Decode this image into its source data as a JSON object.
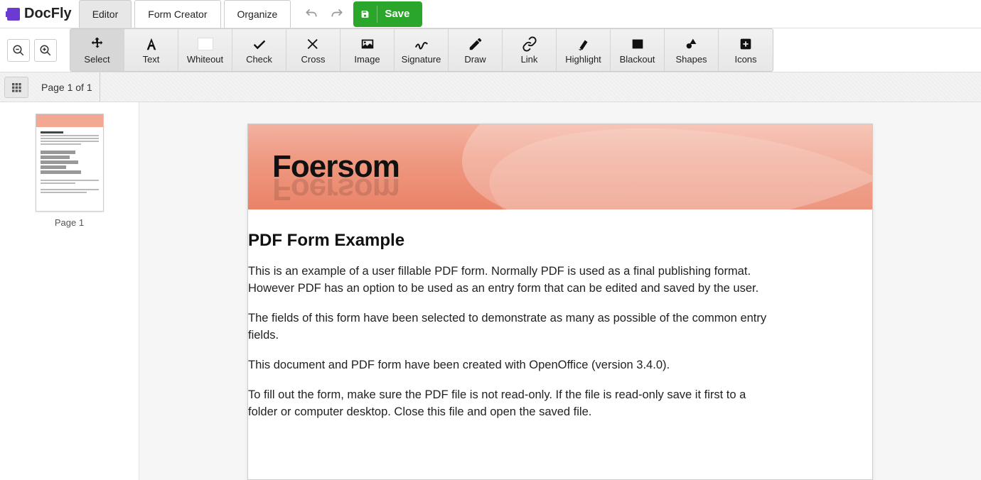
{
  "app": {
    "name": "DocFly"
  },
  "tabs": {
    "editor": "Editor",
    "form_creator": "Form Creator",
    "organize": "Organize"
  },
  "header": {
    "save": "Save"
  },
  "tools": {
    "select": "Select",
    "text": "Text",
    "whiteout": "Whiteout",
    "check": "Check",
    "cross": "Cross",
    "image": "Image",
    "signature": "Signature",
    "draw": "Draw",
    "link": "Link",
    "highlight": "Highlight",
    "blackout": "Blackout",
    "shapes": "Shapes",
    "icons": "Icons"
  },
  "pagebar": {
    "indicator": "Page 1 of 1"
  },
  "sidebar": {
    "thumb_label": "Page 1"
  },
  "document": {
    "banner_title": "Foersom",
    "heading": "PDF Form Example",
    "paragraphs": [
      "This is an example of a user fillable PDF form. Normally PDF is used as a final publishing format. However PDF has an option to be used as an entry form that can be edited and saved by the user.",
      "The fields of this form have been selected to demonstrate as many as possible of the common entry fields.",
      "This document and PDF form have been created with OpenOffice (version 3.4.0).",
      "To fill out the form, make sure the PDF file is not read-only. If the file is read-only save it first to a folder or computer desktop. Close this file and open the saved file."
    ]
  }
}
